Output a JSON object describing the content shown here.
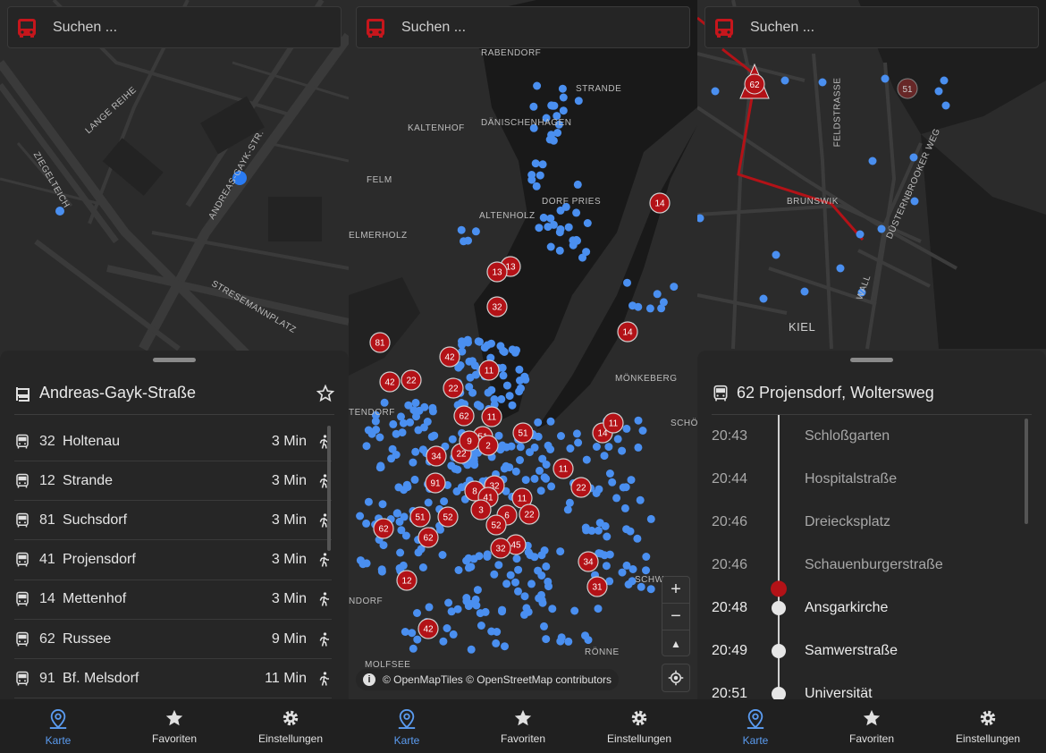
{
  "search": {
    "placeholder": "Suchen ..."
  },
  "nav": {
    "items": [
      {
        "label": "Karte",
        "icon": "map-pin-icon",
        "active": true
      },
      {
        "label": "Favoriten",
        "icon": "star-icon",
        "active": false
      },
      {
        "label": "Einstellungen",
        "icon": "gear-icon",
        "active": false
      }
    ]
  },
  "panel1": {
    "map_labels": [
      "LANGE REIHE",
      "ZIEGELTEICH",
      "ANDREAS-GAYK-STR.",
      "STRESEMANNPLATZ"
    ],
    "stop": {
      "name": "Andreas-Gayk-Straße"
    },
    "departures": [
      {
        "line": "32",
        "destination": "Holtenau",
        "minutes": "3 Min"
      },
      {
        "line": "12",
        "destination": "Strande",
        "minutes": "3 Min"
      },
      {
        "line": "81",
        "destination": "Suchsdorf",
        "minutes": "3 Min"
      },
      {
        "line": "41",
        "destination": "Projensdorf",
        "minutes": "3 Min"
      },
      {
        "line": "14",
        "destination": "Mettenhof",
        "minutes": "3 Min"
      },
      {
        "line": "62",
        "destination": "Russee",
        "minutes": "9 Min"
      },
      {
        "line": "91",
        "destination": "Bf. Melsdorf",
        "minutes": "11 Min"
      }
    ]
  },
  "panel2": {
    "map_labels": [
      "RABENDORF",
      "STRANDE",
      "KALTENHOF",
      "DÄNISCHENHAGEN",
      "FELM",
      "DORF PRIES",
      "ALTENHOLZ",
      "ELMERHOLZ",
      "MÖNKEBERG",
      "TENDORF",
      "SCHÖ",
      "SCHW",
      "RÖNNE",
      "NDORF",
      "MOLFSEE"
    ],
    "bus_markers": [
      "14",
      "13",
      "13",
      "32",
      "14",
      "81",
      "42",
      "42",
      "22",
      "11",
      "22",
      "62",
      "11",
      "14",
      "11",
      "51",
      "34",
      "22",
      "9",
      "2",
      "51",
      "91",
      "8",
      "32",
      "41",
      "11",
      "11",
      "22",
      "6",
      "22",
      "51",
      "52",
      "3",
      "52",
      "62",
      "62",
      "45",
      "32",
      "34",
      "12",
      "31",
      "42"
    ],
    "attribution": "© OpenMapTiles © OpenStreetMap contributors",
    "zoom_in": "+",
    "zoom_out": "−",
    "compass": "▲"
  },
  "panel3": {
    "map_labels": [
      "FEldstraße",
      "BRUNSWIK",
      "DÜSTERNBROOKER WEG",
      "KIEL",
      "WALL"
    ],
    "bus_markers": [
      "62",
      "51"
    ],
    "trip": {
      "title": "62 Projensdorf, Woltersweg"
    },
    "stops": [
      {
        "time": "20:43",
        "name": "Schloßgarten",
        "passed": true
      },
      {
        "time": "20:44",
        "name": "Hospitalstraße",
        "passed": true
      },
      {
        "time": "20:46",
        "name": "Dreiecksplatz",
        "passed": true
      },
      {
        "time": "20:46",
        "name": "Schauenburgerstraße",
        "passed": true
      },
      {
        "time": "20:48",
        "name": "Ansgarkirche",
        "passed": false
      },
      {
        "time": "20:49",
        "name": "Samwerstraße",
        "passed": false
      },
      {
        "time": "20:51",
        "name": "Universität",
        "passed": false
      }
    ]
  },
  "colors": {
    "accent": "#5b9cf1",
    "bus_red": "#b31217",
    "stop_blue": "#4a8ff0"
  }
}
